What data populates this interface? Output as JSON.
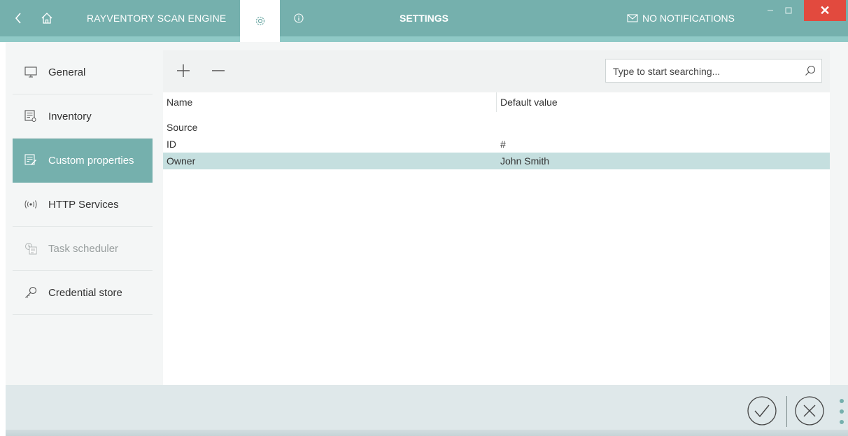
{
  "app": {
    "title": "RAYVENTORY SCAN ENGINE",
    "page_title": "SETTINGS",
    "notifications": "NO NOTIFICATIONS",
    "close_glyph": "✕",
    "accent_color": "#75b0ad",
    "close_color": "#e24a3e"
  },
  "titlebar_icons": [
    "back-icon",
    "home-icon",
    "gear-icon",
    "info-icon",
    "envelope-icon",
    "minimize-icon",
    "maximize-icon",
    "close-icon"
  ],
  "sidebar": {
    "items": [
      {
        "label": "General",
        "icon": "monitor-icon",
        "state": "normal"
      },
      {
        "label": "Inventory",
        "icon": "inventory-icon",
        "state": "normal"
      },
      {
        "label": "Custom properties",
        "icon": "custom-properties-icon",
        "state": "active"
      },
      {
        "label": "HTTP Services",
        "icon": "broadcast-icon",
        "state": "normal"
      },
      {
        "label": "Task scheduler",
        "icon": "calendar-clock-icon",
        "state": "disabled"
      },
      {
        "label": "Credential store",
        "icon": "key-icon",
        "state": "normal"
      }
    ]
  },
  "toolbar": {
    "add_icon": "plus-icon",
    "remove_icon": "minus-icon",
    "search_placeholder": "Type to start searching...",
    "search_icon": "search-icon"
  },
  "grid": {
    "columns": [
      "Name",
      "Default value"
    ],
    "group_label": "Source",
    "rows": [
      {
        "name": "ID",
        "default": "#",
        "selected": false
      },
      {
        "name": "Owner",
        "default": "John Smith",
        "selected": true
      }
    ]
  },
  "footer": {
    "confirm_icon": "check-circle-icon",
    "cancel_icon": "x-circle-icon",
    "more_icon": "more-vertical-icon"
  }
}
